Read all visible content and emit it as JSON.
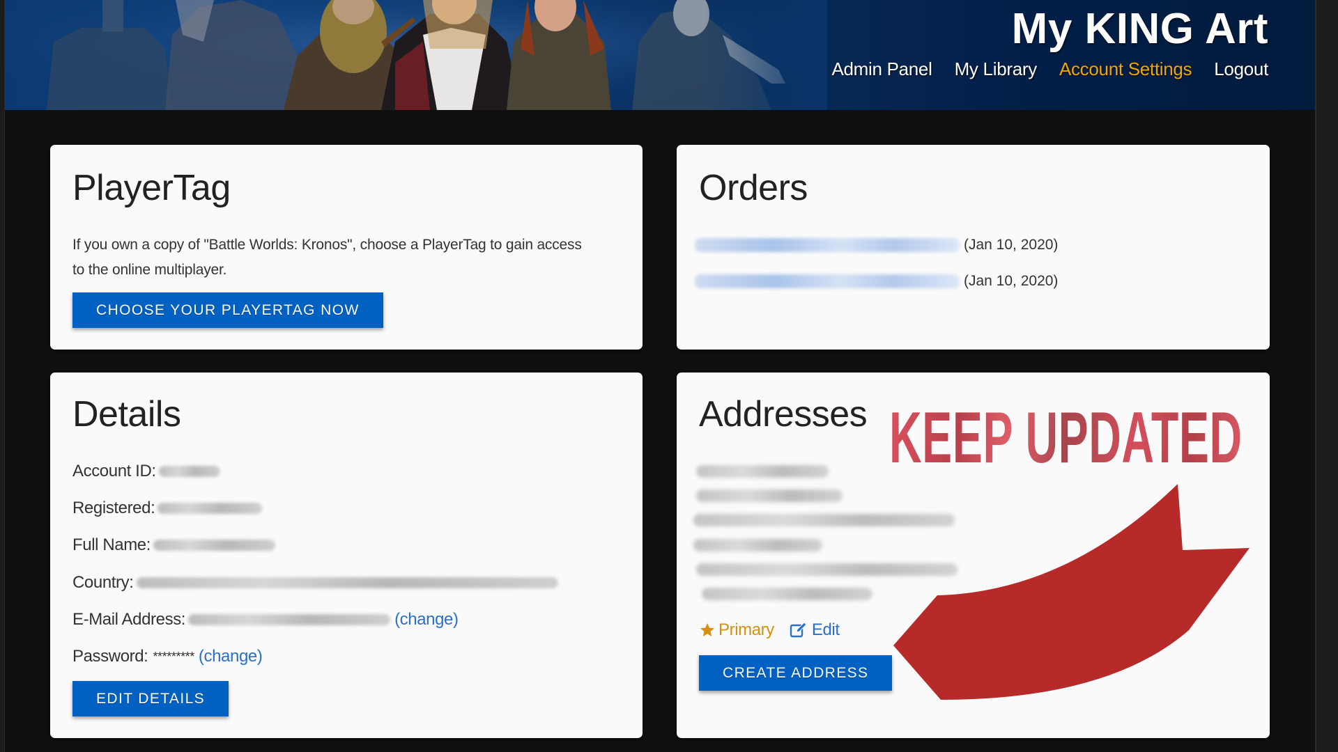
{
  "header": {
    "title": "My KING Art",
    "nav": [
      {
        "label": "Admin Panel",
        "active": false
      },
      {
        "label": "My Library",
        "active": false
      },
      {
        "label": "Account Settings",
        "active": true
      },
      {
        "label": "Logout",
        "active": false
      }
    ],
    "active_color": "#f0a500"
  },
  "playertag": {
    "title": "PlayerTag",
    "description": "If you own a copy of \"Battle Worlds: Kronos\", choose a PlayerTag to gain access to the online multiplayer.",
    "button_label": "CHOOSE YOUR PLAYERTAG NOW"
  },
  "orders": {
    "title": "Orders",
    "items": [
      {
        "name": "[redacted]",
        "date": "(Jan 10, 2020)"
      },
      {
        "name": "[redacted]",
        "date": "(Jan 10, 2020)"
      }
    ]
  },
  "details": {
    "title": "Details",
    "fields": [
      {
        "label": "Account ID:",
        "value": "[redacted]"
      },
      {
        "label": "Registered:",
        "value": "[redacted]"
      },
      {
        "label": "Full Name:",
        "value": "[redacted]"
      },
      {
        "label": "Country:",
        "value": "[redacted]"
      },
      {
        "label": "E-Mail Address:",
        "value": "[redacted]",
        "action": "(change)"
      },
      {
        "label": "Password:",
        "value": "*********",
        "action": "(change)"
      }
    ],
    "button_label": "EDIT DETAILS"
  },
  "addresses": {
    "title": "Addresses",
    "lines": [
      "[redacted]",
      "[redacted]",
      "[redacted]",
      "[redacted]",
      "[redacted]",
      "[redacted]"
    ],
    "primary_label": "Primary",
    "edit_label": "Edit",
    "button_label": "CREATE ADDRESS"
  },
  "overlay": {
    "text": "KEEP UPDATED",
    "arrow_color": "#b72a2a",
    "text_color": "#cc4a56"
  },
  "colors": {
    "button_bg": "#0061c2",
    "link": "#2a6fc9",
    "primary_star": "#d4900f"
  }
}
